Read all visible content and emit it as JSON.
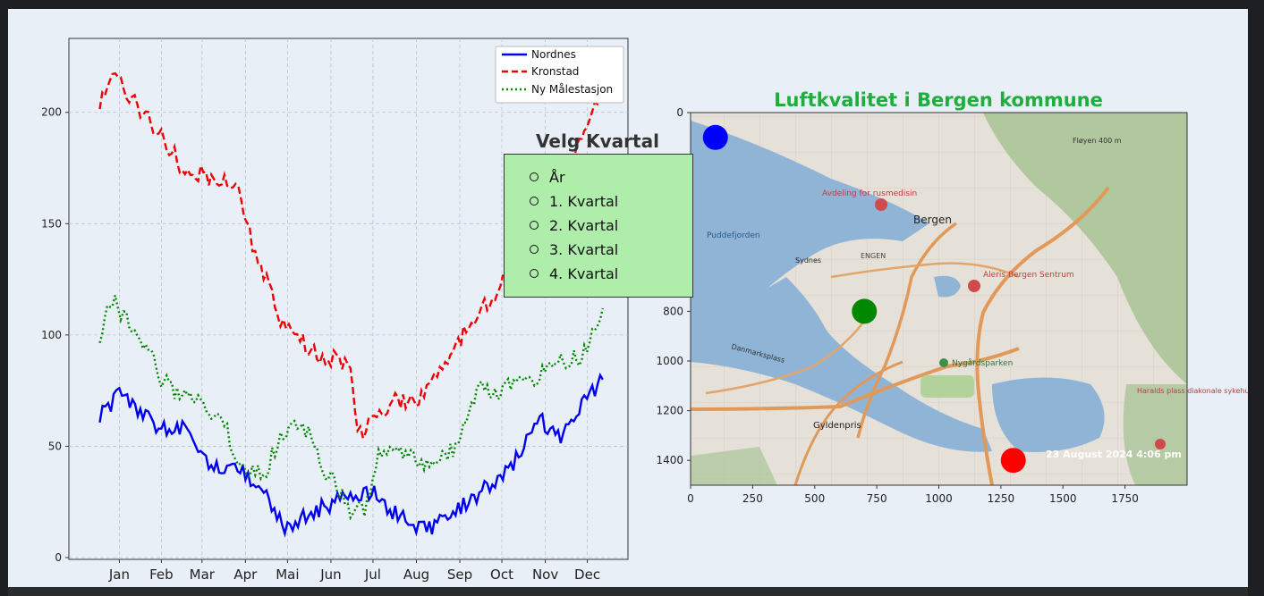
{
  "line_chart": {
    "legend": [
      "Nordnes",
      "Kronstad",
      "Ny Målestasjon"
    ],
    "colors": [
      "#0000ee",
      "#ee0000",
      "#008800"
    ],
    "x_ticks": [
      "Jan",
      "Feb",
      "Mar",
      "Apr",
      "Mai",
      "Jun",
      "Jul",
      "Aug",
      "Sep",
      "Oct",
      "Nov",
      "Dec"
    ],
    "y_ticks": [
      "0",
      "50",
      "100",
      "150",
      "200"
    ]
  },
  "radio": {
    "title": "Velg Kvartal",
    "options": [
      "År",
      "1. Kvartal",
      "2. Kvartal",
      "3. Kvartal",
      "4. Kvartal"
    ]
  },
  "map_chart": {
    "title": "Luftkvalitet i Bergen kommune",
    "x_ticks": [
      "0",
      "250",
      "500",
      "750",
      "1000",
      "1250",
      "1500",
      "1750"
    ],
    "y_ticks": [
      "0",
      "200",
      "400",
      "600",
      "800",
      "1000",
      "1200",
      "1400"
    ],
    "timestamp": "23 August 2024 4:06 pm",
    "place_labels": [
      "Bergen",
      "Puddefjorden",
      "Avdeling for rusmedisin",
      "Aleris Bergen Sentrum",
      "Nygårdsparken",
      "Gyldenpris",
      "Sydnes",
      "ENGEN",
      "Fløyen 400 m",
      "Haralds plass diakonale sykehus",
      "Danmarksplass"
    ],
    "stations": [
      {
        "name": "Nordnes",
        "x": 100,
        "y": 100,
        "color": "#0000ff"
      },
      {
        "name": "Ny Målestasjon",
        "x": 700,
        "y": 800,
        "color": "#008800"
      },
      {
        "name": "Kronstad",
        "x": 1300,
        "y": 1400,
        "color": "#ff0000"
      }
    ]
  },
  "chart_data": [
    {
      "type": "line",
      "title": "",
      "xlabel": "",
      "ylabel": "",
      "x_categories": [
        "Jan",
        "Feb",
        "Mar",
        "Apr",
        "Mai",
        "Jun",
        "Jul",
        "Aug",
        "Sep",
        "Oct",
        "Nov",
        "Dec"
      ],
      "ylim": [
        0,
        230
      ],
      "grid": true,
      "legend_position": "top-right",
      "series": [
        {
          "name": "Nordnes",
          "style": "solid",
          "color": "#0000ee",
          "x_day": [
            1,
            15,
            30,
            45,
            60,
            75,
            90,
            105,
            120,
            135,
            150,
            165,
            180,
            195,
            210,
            225,
            240,
            255,
            270,
            285,
            300,
            315,
            330,
            345,
            360
          ],
          "values": [
            64,
            73,
            65,
            58,
            58,
            45,
            40,
            38,
            27,
            12,
            20,
            24,
            28,
            30,
            21,
            14,
            14,
            20,
            28,
            35,
            45,
            62,
            55,
            70,
            80
          ]
        },
        {
          "name": "Kronstad",
          "style": "dashed",
          "color": "#ee0000",
          "x_day": [
            1,
            10,
            20,
            30,
            45,
            60,
            75,
            90,
            100,
            110,
            120,
            130,
            140,
            150,
            160,
            170,
            180,
            185,
            195,
            210,
            225,
            240,
            255,
            270,
            285,
            300,
            315,
            330,
            345,
            360
          ],
          "values": [
            205,
            220,
            210,
            200,
            190,
            175,
            172,
            168,
            165,
            140,
            125,
            105,
            100,
            95,
            88,
            90,
            85,
            55,
            60,
            70,
            70,
            80,
            95,
            110,
            120,
            135,
            150,
            165,
            190,
            210
          ]
        },
        {
          "name": "Ny Målestasjon",
          "style": "dotted",
          "color": "#008800",
          "x_day": [
            1,
            10,
            20,
            30,
            45,
            60,
            75,
            90,
            100,
            110,
            120,
            130,
            140,
            150,
            160,
            170,
            180,
            190,
            200,
            210,
            225,
            240,
            255,
            270,
            285,
            300,
            315,
            330,
            345,
            360
          ],
          "values": [
            100,
            116,
            107,
            100,
            80,
            72,
            68,
            60,
            42,
            38,
            40,
            55,
            62,
            55,
            40,
            32,
            20,
            22,
            45,
            48,
            45,
            42,
            50,
            75,
            75,
            78,
            82,
            88,
            90,
            112
          ]
        }
      ]
    },
    {
      "type": "scatter",
      "title": "Luftkvalitet i Bergen kommune",
      "xlabel": "",
      "ylabel": "",
      "xlim": [
        0,
        2000
      ],
      "ylim": [
        1500,
        0
      ],
      "points": [
        {
          "label": "Nordnes",
          "x": 100,
          "y": 100,
          "color": "#0000ff"
        },
        {
          "label": "Ny Målestasjon",
          "x": 700,
          "y": 800,
          "color": "#008800"
        },
        {
          "label": "Kronstad",
          "x": 1300,
          "y": 1400,
          "color": "#ff0000"
        }
      ]
    }
  ]
}
